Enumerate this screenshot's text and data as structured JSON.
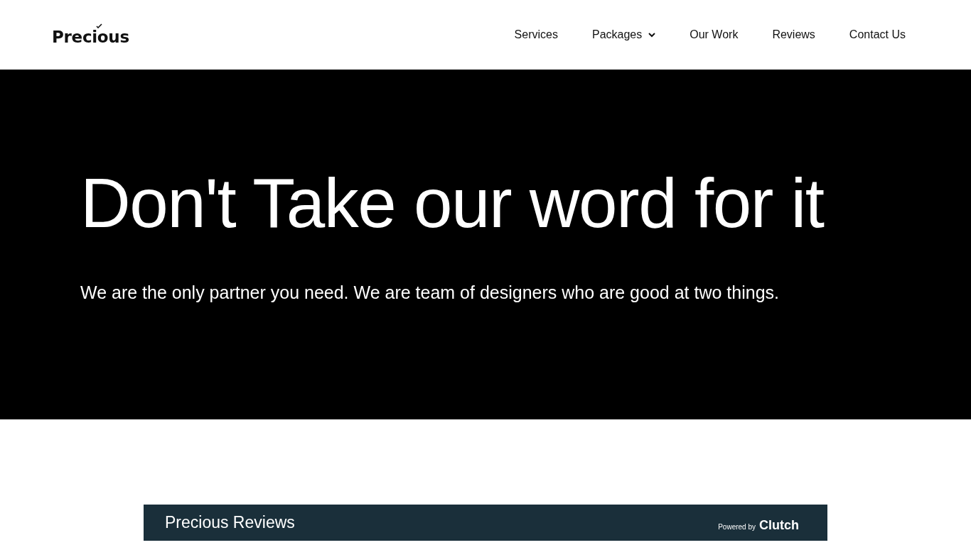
{
  "header": {
    "logo": "Precious",
    "nav": [
      {
        "label": "Services",
        "has_menu": false
      },
      {
        "label": "Packages",
        "has_menu": true
      },
      {
        "label": "Our Work",
        "has_menu": false
      },
      {
        "label": "Reviews",
        "has_menu": false
      },
      {
        "label": "Contact Us",
        "has_menu": false
      }
    ]
  },
  "hero": {
    "title": "Don't Take our word for it",
    "subtitle": "We are the only partner you need. We are team of designers who are good at two things."
  },
  "reviews_widget": {
    "title": "Precious Reviews",
    "powered_by": "Powered by",
    "brand": "Clutch"
  }
}
